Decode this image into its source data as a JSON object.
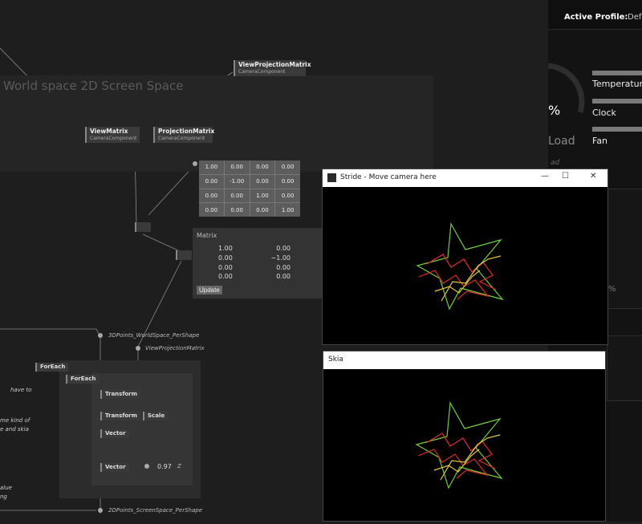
{
  "region": {
    "title": "World space 2D Screen Space"
  },
  "nodes": {
    "view_matrix": {
      "title": "ViewMatrix",
      "sub": "CameraComponent"
    },
    "projection_matrix": {
      "title": "ProjectionMatrix",
      "sub": "CameraComponent"
    },
    "view_projection_matrix": {
      "title": "ViewProjectionMatrix",
      "sub": "CameraComponent"
    },
    "foreach_outer": "ForEach",
    "foreach_inner": "ForEach",
    "transform1": "Transform",
    "transform2": "Transform",
    "scale": "Scale",
    "vector1": "Vector",
    "vector2": "Vector",
    "z_value": "0.97",
    "z_label": "Z"
  },
  "pins": {
    "points3d": "3DPoints_WorldSpace_PerShape",
    "vpm": "ViewProjectionMatrix",
    "points2d": "2DPoints_ScreenSpace_PerShape"
  },
  "matrix_grid": [
    [
      "1.00",
      "0.00",
      "0.00",
      "0.00"
    ],
    [
      "0.00",
      "-1.00",
      "0.00",
      "0.00"
    ],
    [
      "0.00",
      "0.00",
      "1.00",
      "0.00"
    ],
    [
      "0.00",
      "0.00",
      "0.00",
      "1.00"
    ]
  ],
  "matrix_panel": {
    "header": "Matrix",
    "rows": [
      [
        "1.00",
        "0.00"
      ],
      [
        "0.00",
        "−1.00"
      ],
      [
        "0.00",
        "0.00"
      ],
      [
        "0.00",
        "0.00"
      ]
    ],
    "update_label": "Update"
  },
  "comment_lines": [
    "have to",
    "me kind of",
    "e and skia",
    "alue",
    "ng"
  ],
  "right_panel": {
    "active_profile_label": "Active Profile:",
    "active_profile_value": "Defa",
    "percent": "%",
    "load": "Load",
    "temperature": "Temperature",
    "clock": "Clock",
    "fan": "Fan",
    "small_percent": "%",
    "small_text": "ad"
  },
  "windows": {
    "stride": {
      "title": "Stride - Move camera here",
      "minimize": "—",
      "maximize": "☐",
      "close": "✕"
    },
    "skia": {
      "title": "Skia"
    }
  },
  "colors": {
    "accent_green": "#6fcf3a",
    "accent_red": "#e02a2a",
    "accent_yellow": "#e6c83a"
  }
}
